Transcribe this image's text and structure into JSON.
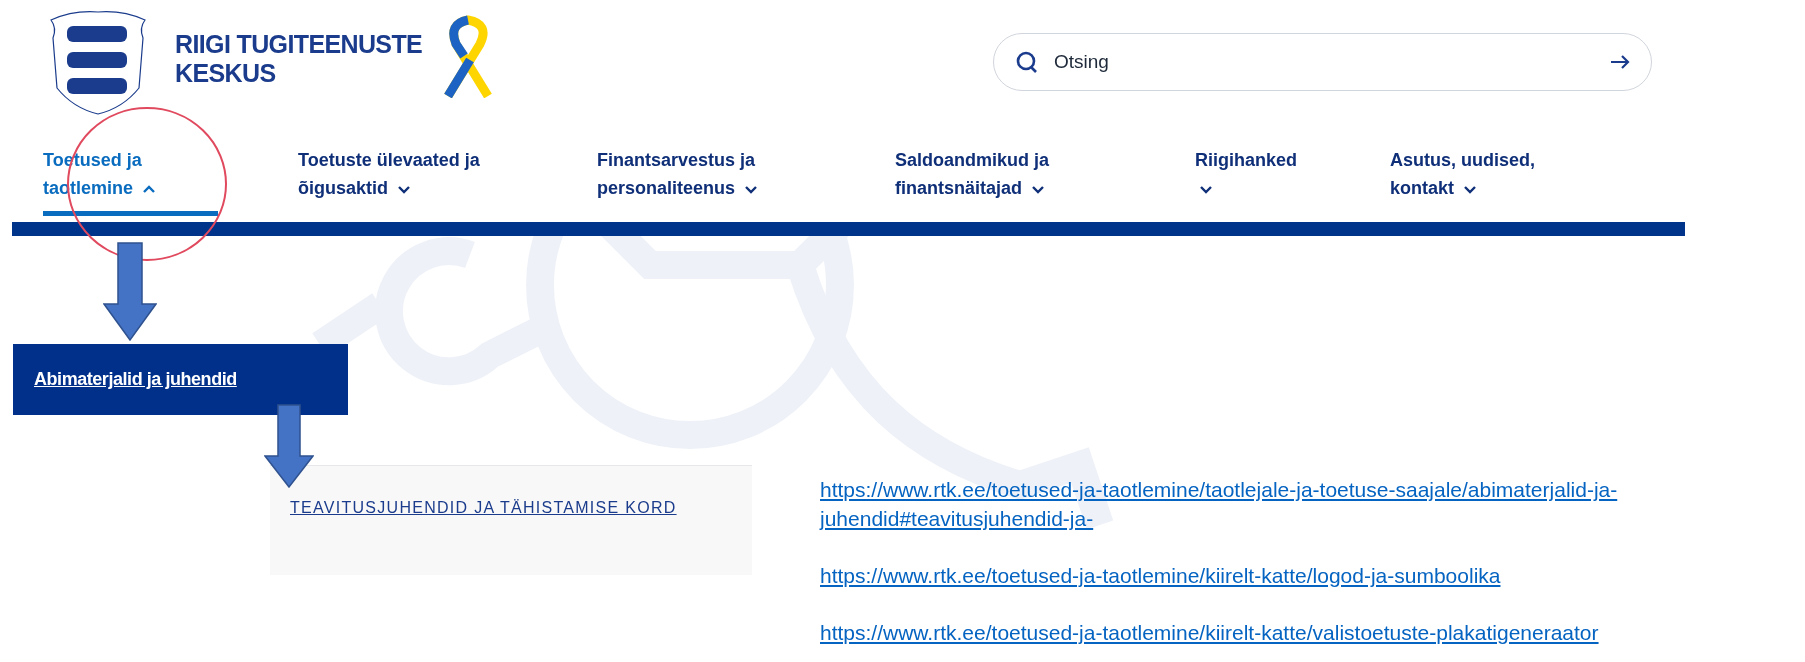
{
  "header": {
    "logo_text": [
      "RIIGI TUGITEENUSTE",
      "KESKUS"
    ]
  },
  "search": {
    "placeholder": "Otsing"
  },
  "nav": [
    {
      "label": "Toetused ja taotlemine",
      "selected": true,
      "expanded": true
    },
    {
      "label": "Toetuste ülevaated ja õigusaktid",
      "selected": false,
      "expanded": false
    },
    {
      "label": "Finantsarvestus ja personaliteenus",
      "selected": false,
      "expanded": false
    },
    {
      "label": "Saldoandmikud ja finantsnäitajad",
      "selected": false,
      "expanded": false
    },
    {
      "label": "Riigihanked",
      "selected": false,
      "expanded": false
    },
    {
      "label": "Asutus, uudised, kontakt",
      "selected": false,
      "expanded": false
    }
  ],
  "submenu": {
    "item": "Abimaterjalid ja juhendid"
  },
  "section_link": "TEAVITUSJUHENDID JA TÄHISTAMISE KORD",
  "urls": [
    "https://www.rtk.ee/toetused-ja-taotlemine/taotlejale-ja-toetuse-saajale/abimaterjalid-ja-juhendid#teavitusjuhendid-ja-",
    "https://www.rtk.ee/toetused-ja-taotlemine/kiirelt-katte/logod-ja-sumboolika",
    "https://www.rtk.ee/toetused-ja-taotlemine/kiirelt-katte/valistoetuste-plakatigeneraator"
  ]
}
